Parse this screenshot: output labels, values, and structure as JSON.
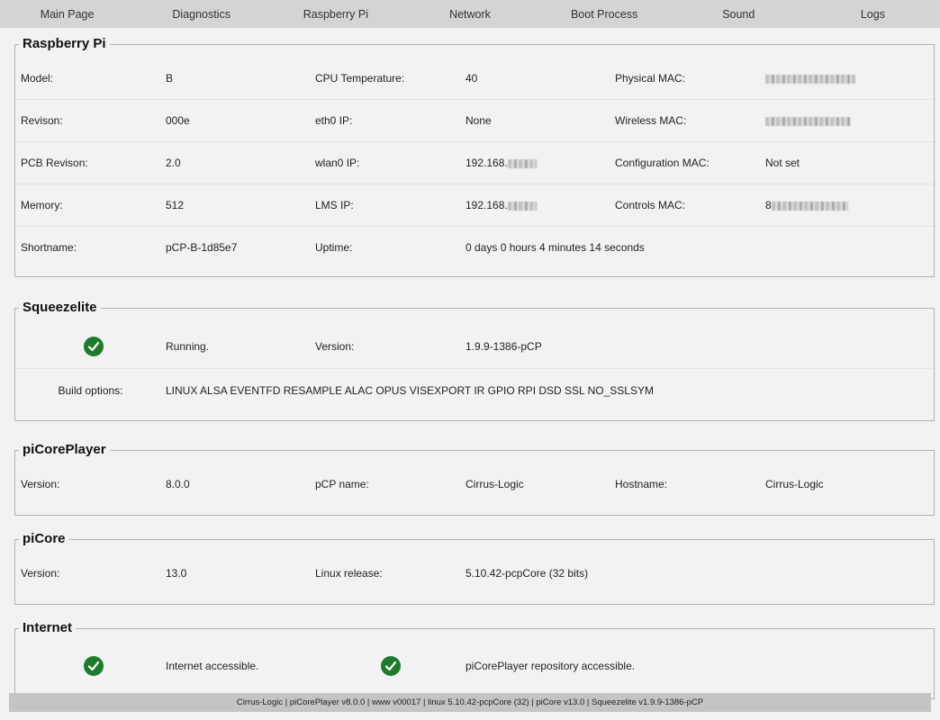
{
  "nav": {
    "items": [
      "Main Page",
      "Diagnostics",
      "Raspberry Pi",
      "Network",
      "Boot Process",
      "Sound",
      "Logs"
    ]
  },
  "raspberry_pi": {
    "title": "Raspberry Pi",
    "model_label": "Model:",
    "model": "B",
    "cpu_temp_label": "CPU Temperature:",
    "cpu_temp": "40",
    "physical_mac_label": "Physical MAC:",
    "revision_label": "Revison:",
    "revision": "000e",
    "eth0_label": "eth0 IP:",
    "eth0": "None",
    "wireless_mac_label": "Wireless MAC:",
    "pcb_label": "PCB Revison:",
    "pcb": "2.0",
    "wlan0_label": "wlan0 IP:",
    "wlan0": "192.168.",
    "config_mac_label": "Configuration MAC:",
    "config_mac": "Not set",
    "memory_label": "Memory:",
    "memory": "512",
    "lms_label": "LMS IP:",
    "lms": "192.168.",
    "controls_mac_label": "Controls MAC:",
    "controls_mac_prefix": "8",
    "shortname_label": "Shortname:",
    "shortname": "pCP-B-1d85e7",
    "uptime_label": "Uptime:",
    "uptime": "0 days 0 hours 4 minutes 14 seconds"
  },
  "squeezelite": {
    "title": "Squeezelite",
    "status": "Running.",
    "version_label": "Version:",
    "version": "1.9.9-1386-pCP",
    "build_label": "Build options:",
    "build": "LINUX ALSA EVENTFD RESAMPLE ALAC OPUS VISEXPORT IR GPIO RPI DSD SSL NO_SSLSYM"
  },
  "picoreplayer": {
    "title": "piCorePlayer",
    "version_label": "Version:",
    "version": "8.0.0",
    "name_label": "pCP name:",
    "name": "Cirrus-Logic",
    "hostname_label": "Hostname:",
    "hostname": "Cirrus-Logic"
  },
  "picore": {
    "title": "piCore",
    "version_label": "Version:",
    "version": "13.0",
    "linux_label": "Linux release:",
    "linux": "5.10.42-pcpCore (32 bits)"
  },
  "internet": {
    "title": "Internet",
    "accessible": "Internet accessible.",
    "repo": "piCorePlayer repository accessible."
  },
  "footer": {
    "text": "Cirrus-Logic | piCorePlayer v8.0.0 | www v00017 | linux 5.10.42-pcpCore (32) | piCore v13.0 | Squeezelite v1.9.9-1386-pCP"
  },
  "colors": {
    "ok_icon": "#1f7a2b",
    "nav_bg": "#d4d4d4",
    "footer_bg": "#c4c4c4"
  },
  "icons": {
    "status_ok": "check-circle-icon"
  }
}
